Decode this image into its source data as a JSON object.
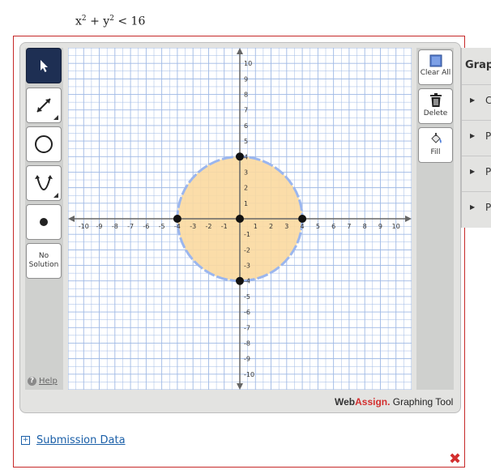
{
  "problem": {
    "text_fragment": "",
    "inequality_lhs": "x",
    "inequality_mid": " + y",
    "inequality_rhs": " < 16",
    "exp": "2"
  },
  "toolbar_left": {
    "no_solution_line1": "No",
    "no_solution_line2": "Solution",
    "help_label": "Help"
  },
  "toolbar_right": {
    "clear_all_label": "Clear All",
    "delete_label": "Delete",
    "fill_label": "Fill"
  },
  "side_panel": {
    "header": "Graph",
    "items": [
      {
        "label": "C"
      },
      {
        "label": "P"
      },
      {
        "label": "P"
      },
      {
        "label": "P"
      }
    ]
  },
  "branding": {
    "name_part1": "Web",
    "name_part2": "Assign.",
    "suffix": " Graphing Tool"
  },
  "footer": {
    "submission_label": "Submission Data",
    "expand_symbol": "+"
  },
  "colors": {
    "accent": "#1e2f53",
    "region_fill": "#fbd9a0",
    "circle_stroke": "#9bb6ee",
    "grid_line": "#9fb9e5",
    "error": "#d32f2f"
  },
  "graph": {
    "x_ticks": [
      "-10",
      "-9",
      "-8",
      "-7",
      "-6",
      "-5",
      "-4",
      "-3",
      "-2",
      "-1",
      "1",
      "2",
      "3",
      "4",
      "5",
      "6",
      "7",
      "8",
      "9",
      "10"
    ],
    "y_ticks": [
      "10",
      "9",
      "8",
      "7",
      "6",
      "5",
      "4",
      "3",
      "2",
      "1",
      "-1",
      "-2",
      "-3",
      "-4",
      "-5",
      "-6",
      "-7",
      "-8",
      "-9",
      "-10"
    ],
    "circle": {
      "center": [
        0,
        0
      ],
      "radius": 4,
      "boundary": "dashed",
      "shaded": "inside"
    },
    "points": [
      [
        0,
        4
      ],
      [
        0,
        -4
      ],
      [
        -4,
        0
      ],
      [
        4,
        0
      ],
      [
        0,
        0
      ]
    ],
    "xlim": [
      -11,
      11
    ],
    "ylim": [
      -11,
      11
    ]
  }
}
